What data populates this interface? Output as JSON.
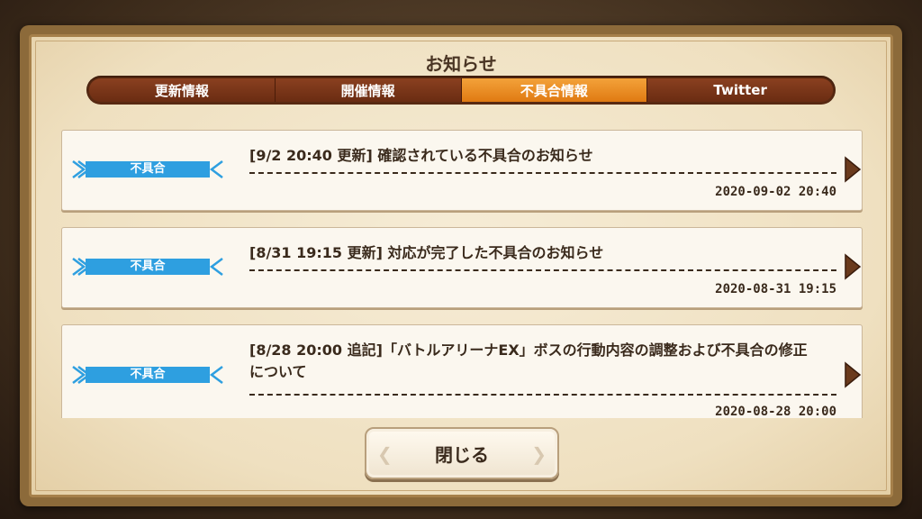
{
  "dialog": {
    "title": "お知らせ"
  },
  "tabs": [
    {
      "label": "更新情報",
      "active": false
    },
    {
      "label": "開催情報",
      "active": false
    },
    {
      "label": "不具合情報",
      "active": true
    },
    {
      "label": "Twitter",
      "active": false
    }
  ],
  "items": [
    {
      "badge": "不具合",
      "message": "[9/2 20:40 更新] 確認されている不具合のお知らせ",
      "date": "2020-09-02 20:40"
    },
    {
      "badge": "不具合",
      "message": "[8/31 19:15 更新] 対応が完了した不具合のお知らせ",
      "date": "2020-08-31 19:15"
    },
    {
      "badge": "不具合",
      "message": "[8/28 20:00 追記]「バトルアリーナEX」ボスの行動内容の調整および不具合の修正について",
      "date": "2020-08-28 20:00"
    }
  ],
  "close_button": {
    "label": "閉じる"
  },
  "colors": {
    "badge": "#2e9fe0",
    "active_tab": "#f08a1e",
    "tab": "#7a3618"
  },
  "icons": {
    "arrow": "chevron-right-icon"
  }
}
